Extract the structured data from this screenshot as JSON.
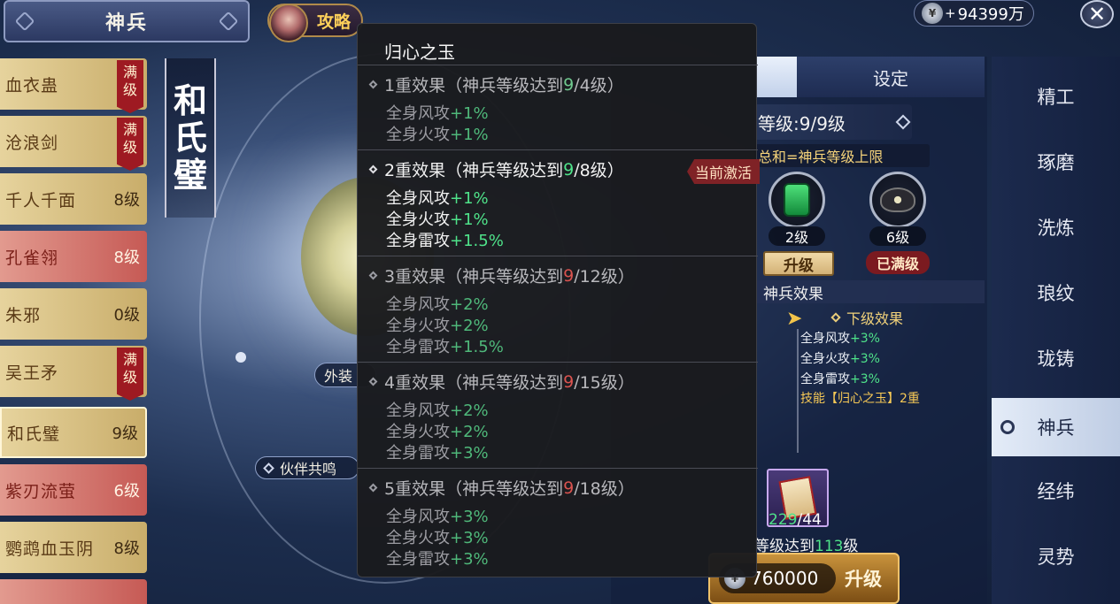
{
  "header": {
    "title": "神兵",
    "guide_label": "攻略"
  },
  "currency": {
    "value": "94399万",
    "plus": "+",
    "coin": "coin-icon"
  },
  "left_list": [
    {
      "name": "血衣蛊",
      "level": "",
      "max": "满级",
      "style": "gold"
    },
    {
      "name": "沧浪剑",
      "level": "",
      "max": "满级",
      "style": "gold"
    },
    {
      "name": "千人千面",
      "level": "8级",
      "max": "",
      "style": "gold"
    },
    {
      "name": "孔雀翎",
      "level": "8级",
      "max": "",
      "style": "red"
    },
    {
      "name": "朱邪",
      "level": "0级",
      "max": "",
      "style": "gold"
    },
    {
      "name": "吴王矛",
      "level": "",
      "max": "满级",
      "style": "gold"
    },
    {
      "name": "和氏璧",
      "level": "9级",
      "max": "",
      "style": "gold",
      "selected": true
    },
    {
      "name": "紫刃流萤",
      "level": "6级",
      "max": "",
      "style": "red"
    },
    {
      "name": "鹦鹉血玉阴",
      "level": "8级",
      "max": "",
      "style": "gold"
    }
  ],
  "center": {
    "vertical_title": [
      "和",
      "氏",
      "璧"
    ],
    "appearance_label": "外装",
    "partner_label": "伙伴共鸣"
  },
  "right_panel": {
    "tab_settings": "设定",
    "level_text": "等级:9/9级",
    "sum_text": "总和=神兵等级上限",
    "gems": [
      {
        "level": "2级",
        "action": "升级"
      },
      {
        "level": "6级",
        "action": "已满级"
      }
    ],
    "effect_header": "神兵效果",
    "next_effect_header": "下级效果",
    "next_effects": [
      {
        "label": "全身风攻",
        "value": "+3%"
      },
      {
        "label": "全身火攻",
        "value": "+3%"
      },
      {
        "label": "全身雷攻",
        "value": "+3%"
      }
    ],
    "skill_text": "技能【归心之玉】2重",
    "book_count_have": "229",
    "book_count_sep": "/",
    "book_count_need": "44",
    "requirement_prefix": "等级达到",
    "requirement_value": "113",
    "requirement_suffix": "级",
    "upgrade_cost": "760000",
    "upgrade_label": "升级"
  },
  "right_nav": [
    "精工",
    "琢磨",
    "洗炼",
    "琅纹",
    "珑铸",
    "神兵",
    "经纬",
    "灵势"
  ],
  "right_nav_selected": 5,
  "popup": {
    "title": "归心之玉",
    "active_tag": "当前激活",
    "sections": [
      {
        "header_prefix": "1重效果（神兵等级达到",
        "cur": "9",
        "sep": "/",
        "need": "4级",
        "suffix": "）",
        "cur_color": "dimgreen",
        "active": false,
        "lines": [
          {
            "label": "全身风攻",
            "value": "+1%"
          },
          {
            "label": "全身火攻",
            "value": "+1%"
          }
        ]
      },
      {
        "header_prefix": "2重效果（神兵等级达到",
        "cur": "9",
        "sep": "/",
        "need": "8级",
        "suffix": "）",
        "cur_color": "green",
        "active": true,
        "lines": [
          {
            "label": "全身风攻",
            "value": "+1%"
          },
          {
            "label": "全身火攻",
            "value": "+1%"
          },
          {
            "label": "全身雷攻",
            "value": "+1.5%"
          }
        ]
      },
      {
        "header_prefix": "3重效果（神兵等级达到",
        "cur": "9",
        "sep": "/",
        "need": "12级",
        "suffix": "）",
        "cur_color": "red",
        "active": false,
        "lines": [
          {
            "label": "全身风攻",
            "value": "+2%"
          },
          {
            "label": "全身火攻",
            "value": "+2%"
          },
          {
            "label": "全身雷攻",
            "value": "+1.5%"
          }
        ]
      },
      {
        "header_prefix": "4重效果（神兵等级达到",
        "cur": "9",
        "sep": "/",
        "need": "15级",
        "suffix": "）",
        "cur_color": "red",
        "active": false,
        "lines": [
          {
            "label": "全身风攻",
            "value": "+2%"
          },
          {
            "label": "全身火攻",
            "value": "+2%"
          },
          {
            "label": "全身雷攻",
            "value": "+3%"
          }
        ]
      },
      {
        "header_prefix": "5重效果（神兵等级达到",
        "cur": "9",
        "sep": "/",
        "need": "18级",
        "suffix": "）",
        "cur_color": "red",
        "active": false,
        "lines": [
          {
            "label": "全身风攻",
            "value": "+3%"
          },
          {
            "label": "全身火攻",
            "value": "+3%"
          },
          {
            "label": "全身雷攻",
            "value": "+3%"
          }
        ]
      }
    ]
  },
  "colors": {
    "green_value": "#4fe38a",
    "red_level": "#d9534f",
    "gold_text": "#f5c856"
  }
}
